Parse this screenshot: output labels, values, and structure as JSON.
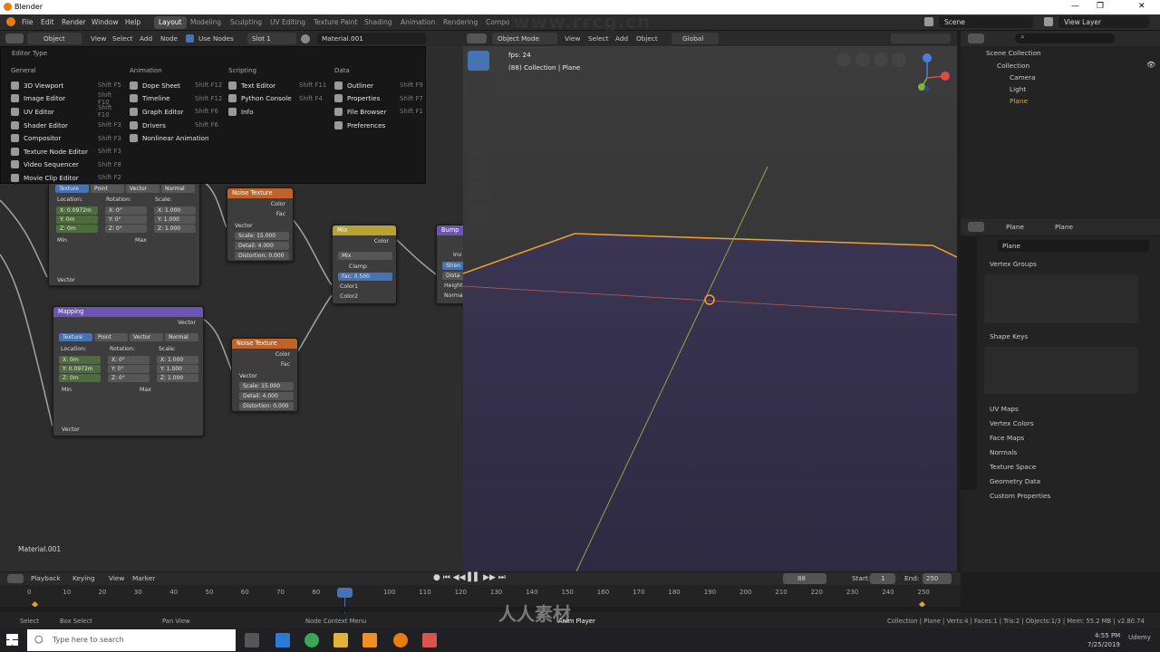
{
  "window": {
    "title": "Blender"
  },
  "menubar": {
    "items": [
      "File",
      "Edit",
      "Render",
      "Window",
      "Help"
    ]
  },
  "workspaces": [
    "Layout",
    "Modeling",
    "Sculpting",
    "UV Editing",
    "Texture Paint",
    "Shading",
    "Animation",
    "Rendering",
    "Compo"
  ],
  "scene": {
    "name": "Scene",
    "view_layer": "View Layer"
  },
  "node_header": {
    "mode": "Object",
    "menus": [
      "View",
      "Select",
      "Add",
      "Node"
    ],
    "use_nodes": "Use Nodes",
    "slot": "Slot 1",
    "material": "Material.001"
  },
  "editor_type_popup": {
    "title": "Editor Type",
    "general": {
      "header": "General",
      "items": [
        {
          "label": "3D Viewport",
          "shortcut": "Shift F5"
        },
        {
          "label": "Image Editor",
          "shortcut": "Shift F10"
        },
        {
          "label": "UV Editor",
          "shortcut": "Shift F10"
        },
        {
          "label": "Shader Editor",
          "shortcut": "Shift F3"
        },
        {
          "label": "Compositor",
          "shortcut": "Shift F3"
        },
        {
          "label": "Texture Node Editor",
          "shortcut": "Shift F3"
        },
        {
          "label": "Video Sequencer",
          "shortcut": "Shift F8"
        },
        {
          "label": "Movie Clip Editor",
          "shortcut": "Shift F2"
        }
      ]
    },
    "animation": {
      "header": "Animation",
      "items": [
        {
          "label": "Dope Sheet",
          "shortcut": "Shift F12"
        },
        {
          "label": "Timeline",
          "shortcut": "Shift F12"
        },
        {
          "label": "Graph Editor",
          "shortcut": "Shift F6"
        },
        {
          "label": "Drivers",
          "shortcut": "Shift F6"
        },
        {
          "label": "Nonlinear Animation",
          "shortcut": ""
        }
      ]
    },
    "scripting": {
      "header": "Scripting",
      "items": [
        {
          "label": "Text Editor",
          "shortcut": "Shift F11"
        },
        {
          "label": "Python Console",
          "shortcut": "Shift F4"
        },
        {
          "label": "Info",
          "shortcut": ""
        }
      ]
    },
    "data": {
      "header": "Data",
      "items": [
        {
          "label": "Outliner",
          "shortcut": "Shift F9"
        },
        {
          "label": "Properties",
          "shortcut": "Shift F7"
        },
        {
          "label": "File Browser",
          "shortcut": "Shift F1"
        },
        {
          "label": "Preferences",
          "shortcut": ""
        }
      ]
    }
  },
  "nodes": {
    "mapping1": {
      "tabs": [
        "Texture",
        "Point",
        "Vector",
        "Normal"
      ],
      "location": "Location:",
      "rotation": "Rotation:",
      "scale": "Scale:",
      "loc": [
        "X: 0.0972m",
        "Y: 0m",
        "Z: 0m"
      ],
      "rot": [
        "X: 0°",
        "Y: 0°",
        "Z: 0°"
      ],
      "scl": [
        "X: 1.000",
        "Y: 1.000",
        "Z: 1.000"
      ],
      "min": "Min",
      "max": "Max",
      "vector": "Vector"
    },
    "noise1": {
      "title": "Noise Texture",
      "color": "Color",
      "fac": "Fac",
      "vector": "Vector",
      "scale": "Scale: 15.000",
      "detail": "Detail: 4.000",
      "distortion": "Distortion: 0.000"
    },
    "mix": {
      "title": "Mix",
      "color": "Color",
      "mode": "Mix",
      "clamp": "Clamp",
      "fac": "Fac: 0.500",
      "c1": "Color1",
      "c2": "Color2"
    },
    "bump": {
      "title": "Bump",
      "inv": "Inv",
      "strength": "Stren",
      "dist": "Dista",
      "height": "Height",
      "normal": "Norma"
    },
    "mapping2": {
      "title": "Mapping",
      "vector_out": "Vector",
      "tabs": [
        "Texture",
        "Point",
        "Vector",
        "Normal"
      ],
      "location": "Location:",
      "rotation": "Rotation:",
      "scale": "Scale:",
      "loc": [
        "X: 0m",
        "Y: 0.0972m",
        "Z: 0m"
      ],
      "rot": [
        "X: 0°",
        "Y: 0°",
        "Z: 0°"
      ],
      "scl": [
        "X: 1.000",
        "Y: 1.000",
        "Z: 1.000"
      ],
      "min": "Min",
      "max": "Max",
      "vector": "Vector"
    },
    "noise2": {
      "title": "Noise Texture",
      "color": "Color",
      "fac": "Fac",
      "vector": "Vector",
      "scale": "Scale: 15.000",
      "detail": "Detail: 4.000",
      "distortion": "Distortion: 0.000"
    },
    "material_label": "Material.001"
  },
  "viewport": {
    "mode": "Object Mode",
    "menus": [
      "View",
      "Select",
      "Add",
      "Object"
    ],
    "orientation": "Global",
    "fps": "fps: 24",
    "collection_info": "(88) Collection | Plane"
  },
  "outliner": {
    "root": "Scene Collection",
    "collection": "Collection",
    "items": [
      "Camera",
      "Light",
      "Plane"
    ]
  },
  "properties": {
    "object": "Plane",
    "data": "Plane",
    "name_field": "Plane",
    "sections": [
      "Vertex Groups",
      "Shape Keys",
      "UV Maps",
      "Vertex Colors",
      "Face Maps",
      "Normals",
      "Texture Space",
      "Geometry Data",
      "Custom Properties"
    ]
  },
  "timeline": {
    "menus": [
      "Playback",
      "Keying",
      "View",
      "Marker"
    ],
    "current_frame": "88",
    "start_label": "Start:",
    "start": "1",
    "end_label": "End:",
    "end": "250",
    "ticks": [
      "0",
      "10",
      "20",
      "30",
      "40",
      "50",
      "60",
      "70",
      "80",
      "88",
      "100",
      "110",
      "120",
      "130",
      "140",
      "150",
      "160",
      "170",
      "180",
      "190",
      "200",
      "210",
      "220",
      "230",
      "240",
      "250"
    ]
  },
  "statusbar": {
    "select": "Select",
    "box_select": "Box Select",
    "pan_view": "Pan View",
    "node_context": "Node Context Menu",
    "anim_player": "Anim Player",
    "stats": "Collection | Plane | Verts:4 | Faces:1 | Tris:2 | Objects:1/3 | Mem: 55.2 MB | v2.80.74"
  },
  "taskbar": {
    "search": "Type here to search",
    "time": "4:55 PM",
    "date": "7/25/2019",
    "udemy": "Udemy"
  },
  "watermark": {
    "site": "www.rrcg.cn",
    "cn": "人人素材"
  },
  "colors": {
    "accent": "#4772b3",
    "selection": "#f0a030",
    "noise_header": "#c0632a",
    "mix_header": "#b8a233",
    "mapping_header": "#6a56b2",
    "bump_header": "#6a56b2"
  }
}
